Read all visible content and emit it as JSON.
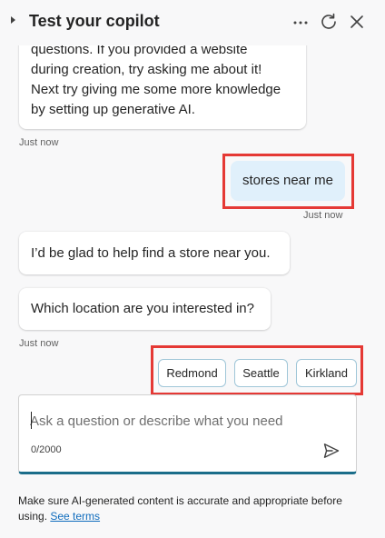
{
  "header": {
    "title": "Test your copilot",
    "more_icon": "more-horizontal-icon",
    "refresh_icon": "refresh-icon",
    "close_icon": "close-icon"
  },
  "messages": [
    {
      "role": "bot",
      "text": "questions. If you provided a website\nduring creation, try asking me about it!\nNext try giving me some more knowledge\nby setting up generative AI.",
      "timestamp": "Just now"
    },
    {
      "role": "user",
      "text": "stores near me",
      "timestamp": "Just now"
    },
    {
      "role": "bot",
      "text": "I’d be glad to help find a store near you."
    },
    {
      "role": "bot",
      "text": "Which location are you interested in?",
      "timestamp": "Just now"
    }
  ],
  "suggestions": [
    "Redmond",
    "Seattle",
    "Kirkland"
  ],
  "input": {
    "placeholder": "Ask a question or describe what you need",
    "value": "",
    "counter": "0/2000",
    "send_icon": "send-icon"
  },
  "disclaimer": {
    "text": "Make sure AI-generated content is accurate and appropriate before using. ",
    "link": "See terms"
  },
  "colors": {
    "user_bubble": "#e0f0fb",
    "highlight_border": "#e53935",
    "input_accent": "#1b6d8a",
    "link": "#0f6cbd"
  }
}
